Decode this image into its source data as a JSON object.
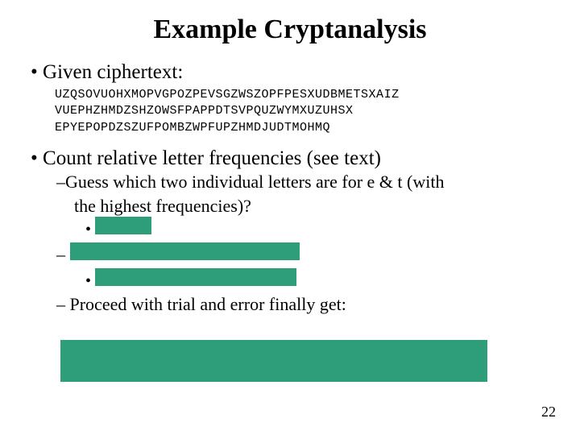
{
  "title": "Example Cryptanalysis",
  "bullets": {
    "given": "Given ciphertext:",
    "count": "Count relative letter frequencies (see text)",
    "guess_line1": "Guess which two individual letters are for e & t (with",
    "guess_line2": "the highest frequencies)?",
    "proceed": "Proceed with trial and error finally get:"
  },
  "ciphertext": {
    "l1": "UZQSOVUOHXMOPVGPOZPEVSGZWSZOPFPESXUDBMETSXAIZ",
    "l2": "VUEPHZHMDZSHZOWSFPAPPDTSVPQUZWYMXUZUHSX",
    "l3": "EPYEPOPDZSZUFPOMBZWPFUPZHMDJUDTMOHMQ"
  },
  "pagenum": "22"
}
